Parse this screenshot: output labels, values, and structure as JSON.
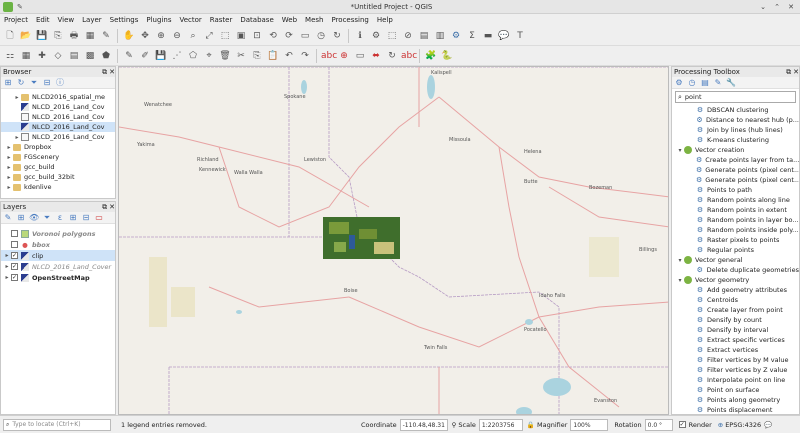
{
  "window": {
    "title": "*Untitled Project - QGIS"
  },
  "menu": [
    "Project",
    "Edit",
    "View",
    "Layer",
    "Settings",
    "Plugins",
    "Vector",
    "Raster",
    "Database",
    "Web",
    "Mesh",
    "Processing",
    "Help"
  ],
  "browser": {
    "title": "Browser",
    "items": [
      {
        "label": "NLCD2016_spatial_me",
        "icon": "folder",
        "indent": 2
      },
      {
        "label": "NLCD_2016_Land_Cov",
        "icon": "raster",
        "indent": 2
      },
      {
        "label": "NLCD_2016_Land_Cov",
        "icon": "vector",
        "indent": 2
      },
      {
        "label": "NLCD_2016_Land_Cov",
        "icon": "raster",
        "indent": 2,
        "selected": true
      },
      {
        "label": "NLCD_2016_Land_Cov",
        "icon": "file",
        "indent": 2
      },
      {
        "label": "Dropbox",
        "icon": "folder",
        "indent": 1
      },
      {
        "label": "FGScenery",
        "icon": "folder",
        "indent": 1
      },
      {
        "label": "gcc_build",
        "icon": "folder",
        "indent": 1
      },
      {
        "label": "gcc_build_32bit",
        "icon": "folder",
        "indent": 1
      },
      {
        "label": "kdenlive",
        "icon": "folder",
        "indent": 1
      }
    ]
  },
  "layers": {
    "title": "Layers",
    "items": [
      {
        "label": "Voronoi polygons",
        "checked": false,
        "style": "italic-gray"
      },
      {
        "label": "bbox",
        "checked": false,
        "style": "italic-gray"
      },
      {
        "label": "clip",
        "checked": true,
        "style": "selected"
      },
      {
        "label": "NLCD_2016_Land_Cover",
        "checked": true,
        "style": "italic-gray"
      },
      {
        "label": "OpenStreetMap",
        "checked": true,
        "style": "bold"
      }
    ]
  },
  "processing": {
    "title": "Processing Toolbox",
    "search_value": "point",
    "items": [
      {
        "label": "DBSCAN clustering",
        "type": "algo"
      },
      {
        "label": "Distance to nearest hub (p...",
        "type": "algo"
      },
      {
        "label": "Join by lines (hub lines)",
        "type": "algo"
      },
      {
        "label": "K-means clustering",
        "type": "algo"
      },
      {
        "label": "Vector creation",
        "type": "group"
      },
      {
        "label": "Create points layer from ta...",
        "type": "algo"
      },
      {
        "label": "Generate points (pixel cent...",
        "type": "algo"
      },
      {
        "label": "Generate points (pixel cent...",
        "type": "algo"
      },
      {
        "label": "Points to path",
        "type": "algo"
      },
      {
        "label": "Random points along line",
        "type": "algo"
      },
      {
        "label": "Random points in extent",
        "type": "algo"
      },
      {
        "label": "Random points in layer bo...",
        "type": "algo"
      },
      {
        "label": "Random points inside poly...",
        "type": "algo"
      },
      {
        "label": "Raster pixels to points",
        "type": "algo"
      },
      {
        "label": "Regular points",
        "type": "algo"
      },
      {
        "label": "Vector general",
        "type": "group"
      },
      {
        "label": "Delete duplicate geometries",
        "type": "algo"
      },
      {
        "label": "Vector geometry",
        "type": "group"
      },
      {
        "label": "Add geometry attributes",
        "type": "algo"
      },
      {
        "label": "Centroids",
        "type": "algo"
      },
      {
        "label": "Create layer from point",
        "type": "algo"
      },
      {
        "label": "Densify by count",
        "type": "algo"
      },
      {
        "label": "Densify by interval",
        "type": "algo"
      },
      {
        "label": "Extract specific vertices",
        "type": "algo"
      },
      {
        "label": "Extract vertices",
        "type": "algo"
      },
      {
        "label": "Filter vertices by M value",
        "type": "algo"
      },
      {
        "label": "Filter vertices by Z value",
        "type": "algo"
      },
      {
        "label": "Interpolate point on line",
        "type": "algo"
      },
      {
        "label": "Point on surface",
        "type": "algo"
      },
      {
        "label": "Points along geometry",
        "type": "algo"
      },
      {
        "label": "Points displacement",
        "type": "algo"
      }
    ]
  },
  "map_labels": [
    {
      "text": "Kalispell"
    },
    {
      "text": "Spokane"
    },
    {
      "text": "Wenatchee"
    },
    {
      "text": "Yakima"
    },
    {
      "text": "Richland"
    },
    {
      "text": "Kennewick"
    },
    {
      "text": "Walla Walla"
    },
    {
      "text": "Lewiston"
    },
    {
      "text": "Missoula"
    },
    {
      "text": "Helena"
    },
    {
      "text": "Butte"
    },
    {
      "text": "Bozeman"
    },
    {
      "text": "Billings"
    },
    {
      "text": "Boise"
    },
    {
      "text": "Idaho Falls"
    },
    {
      "text": "Pocatello"
    },
    {
      "text": "Twin Falls"
    },
    {
      "text": "Evanston"
    }
  ],
  "status": {
    "locate_placeholder": "Type to locate (Ctrl+K)",
    "message": "1 legend entries removed.",
    "coordinate_label": "Coordinate",
    "coordinate_value": "-110.48,48.31",
    "scale_label": "Scale",
    "scale_value": "1:2203756",
    "magnifier_label": "Magnifier",
    "magnifier_value": "100%",
    "rotation_label": "Rotation",
    "rotation_value": "0.0 °",
    "render_label": "Render",
    "crs_label": "EPSG:4326"
  },
  "colors": {
    "accent": "#6bb344",
    "selection": "#cfe3f8",
    "map_bg": "#f2efe9"
  }
}
